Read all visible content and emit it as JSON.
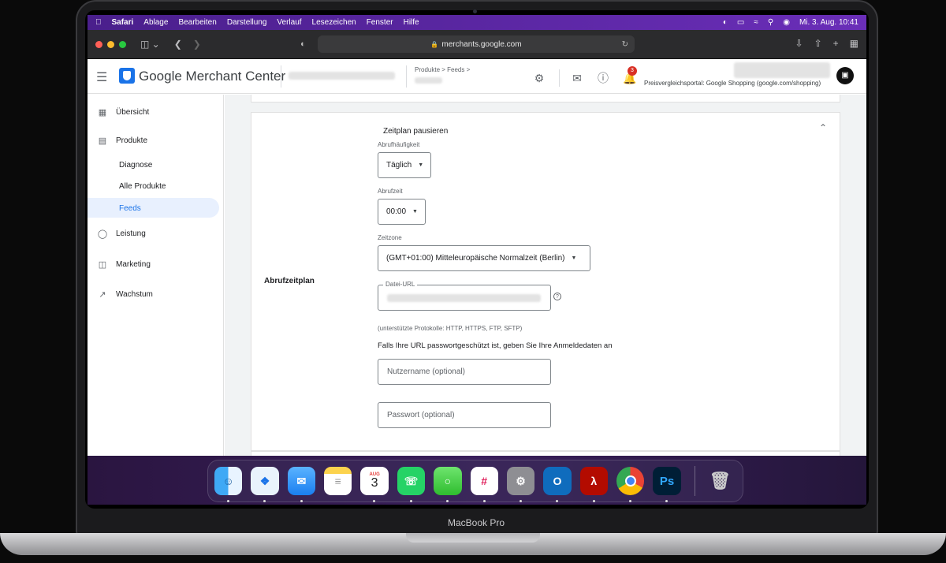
{
  "menubar": {
    "apple": "",
    "items": [
      "Safari",
      "Ablage",
      "Bearbeiten",
      "Darstellung",
      "Verlauf",
      "Lesezeichen",
      "Fenster",
      "Hilfe"
    ],
    "date_time": "Mi. 3. Aug.  10:41"
  },
  "browser": {
    "url": "merchants.google.com"
  },
  "app": {
    "name": "Google Merchant Center",
    "breadcrumb": "Produkte > Feeds >",
    "notification_count": "3",
    "portal": "Preisvergleichsportal: Google Shopping (google.com/shopping)"
  },
  "sidebar": {
    "items": [
      {
        "label": "Übersicht"
      },
      {
        "label": "Produkte"
      },
      {
        "label": "Diagnose"
      },
      {
        "label": "Alle Produkte"
      },
      {
        "label": "Feeds"
      },
      {
        "label": "Leistung"
      },
      {
        "label": "Marketing"
      },
      {
        "label": "Wachstum"
      }
    ]
  },
  "form": {
    "section_label": "Abrufzeitplan",
    "pause_title": "Zeitplan pausieren",
    "frequency_label": "Abrufhäufigkeit",
    "frequency_value": "Täglich",
    "time_label": "Abrufzeit",
    "time_value": "00:00",
    "timezone_label": "Zeitzone",
    "timezone_value": "(GMT+01:00) Mitteleuropäische Normalzeit (Berlin)",
    "file_url_label": "Datei-URL",
    "protocols_note": "(unterstützte Protokolle: HTTP, HTTPS, FTP, SFTP)",
    "password_info": "Falls Ihre URL passwortgeschützt ist, geben Sie Ihre Anmeldedaten an",
    "username_placeholder": "Nutzername (optional)",
    "password_placeholder": "Passwort (optional)"
  },
  "dock": {
    "calendar_month": "AUG",
    "calendar_day": "3",
    "photoshop": "Ps"
  },
  "device": {
    "label": "MacBook Pro"
  }
}
